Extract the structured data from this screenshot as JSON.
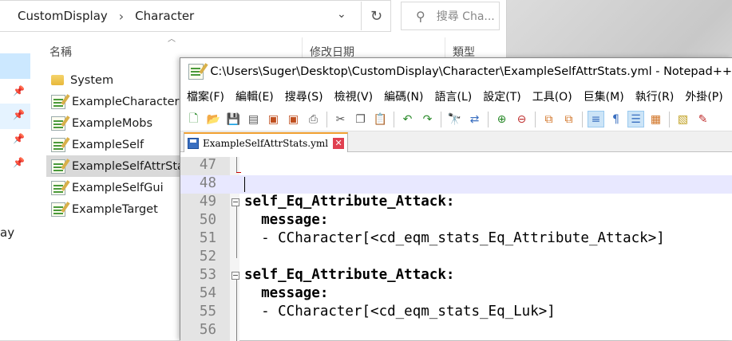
{
  "explorer": {
    "breadcrumb": [
      "CustomDisplay",
      "Character"
    ],
    "search_placeholder": "搜尋 Cha...",
    "columns": {
      "name": "名稱",
      "date": "修改日期",
      "type": "類型"
    },
    "nav_label": "ay",
    "files": [
      {
        "name": "System",
        "type": "folder"
      },
      {
        "name": "ExampleCharacter",
        "type": "yml"
      },
      {
        "name": "ExampleMobs",
        "type": "yml"
      },
      {
        "name": "ExampleSelf",
        "type": "yml"
      },
      {
        "name": "ExampleSelfAttrStat",
        "type": "yml",
        "selected": true
      },
      {
        "name": "ExampleSelfGui",
        "type": "yml"
      },
      {
        "name": "ExampleTarget",
        "type": "yml"
      }
    ]
  },
  "notepad": {
    "title": "C:\\Users\\Suger\\Desktop\\CustomDisplay\\Character\\ExampleSelfAttrStats.yml - Notepad++",
    "menu": [
      "檔案(F)",
      "編輯(E)",
      "搜尋(S)",
      "檢視(V)",
      "編碼(N)",
      "語言(L)",
      "設定(T)",
      "工具(O)",
      "巨集(M)",
      "執行(R)",
      "外掛(P)"
    ],
    "tab_label": "ExampleSelfAttrStats.yml",
    "lines": [
      {
        "num": "47",
        "text": ""
      },
      {
        "num": "48",
        "text": ""
      },
      {
        "num": "49",
        "text": "self_Eq_Attribute_Attack:"
      },
      {
        "num": "50",
        "text": "  message:"
      },
      {
        "num": "51",
        "text": "  - CCharacter[<cd_eqm_stats_Eq_Attribute_Attack>]"
      },
      {
        "num": "52",
        "text": ""
      },
      {
        "num": "53",
        "text": "self_Eq_Attribute_Attack:"
      },
      {
        "num": "54",
        "text": "  message:"
      },
      {
        "num": "55",
        "text": "  - CCharacter[<cd_eqm_stats_Eq_Luk>]"
      },
      {
        "num": "56",
        "text": ""
      }
    ]
  }
}
